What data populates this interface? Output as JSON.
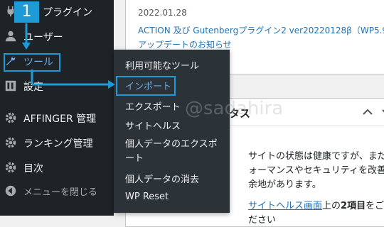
{
  "sidebar": {
    "items": [
      {
        "label": "プラグイン",
        "icon": "plugin-icon"
      },
      {
        "label": "ユーザー",
        "icon": "user-icon"
      },
      {
        "label": "ツール",
        "icon": "wrench-icon"
      },
      {
        "label": "設定",
        "icon": "settings-icon"
      },
      {
        "label": "AFFINGER 管理",
        "icon": "gear-icon"
      },
      {
        "label": "ランキング管理",
        "icon": "gear-icon"
      },
      {
        "label": "目次",
        "icon": "gear-icon"
      },
      {
        "label": "メニューを閉じる",
        "icon": "collapse-icon"
      }
    ]
  },
  "flyout": {
    "items": [
      {
        "label": "利用可能なツール"
      },
      {
        "label": "インポート"
      },
      {
        "label": "エクスポート"
      },
      {
        "label": "サイトヘルス"
      },
      {
        "label": "個人データのエクスポート"
      },
      {
        "label": "個人データの消去"
      },
      {
        "label": "WP Reset"
      }
    ]
  },
  "news": {
    "date": "2022.01.28",
    "title_line1": "ACTION 及び Gutenbergプラグイン2 ver20220128β（WP5.9",
    "title_line2": "アップデートのお知らせ"
  },
  "health": {
    "heading": "タス",
    "text_line1": "サイトの状態は健康ですが、まだ",
    "text_line2": "ォーマンスやセキュリティを改善",
    "text_line3": "余地があります。",
    "link": "サイトヘルス画面",
    "text_after_link": "上の",
    "bold_count": "2項目",
    "text_end": "をご",
    "partial_line": "ださい"
  },
  "annotation": {
    "step": "1",
    "color": "#1e9bd7"
  },
  "watermark": "@sadahira",
  "colors": {
    "admin_bg": "#1d2327",
    "flyout_bg": "#2c3338",
    "link": "#2271b1",
    "callout": "#1e9bd7"
  }
}
